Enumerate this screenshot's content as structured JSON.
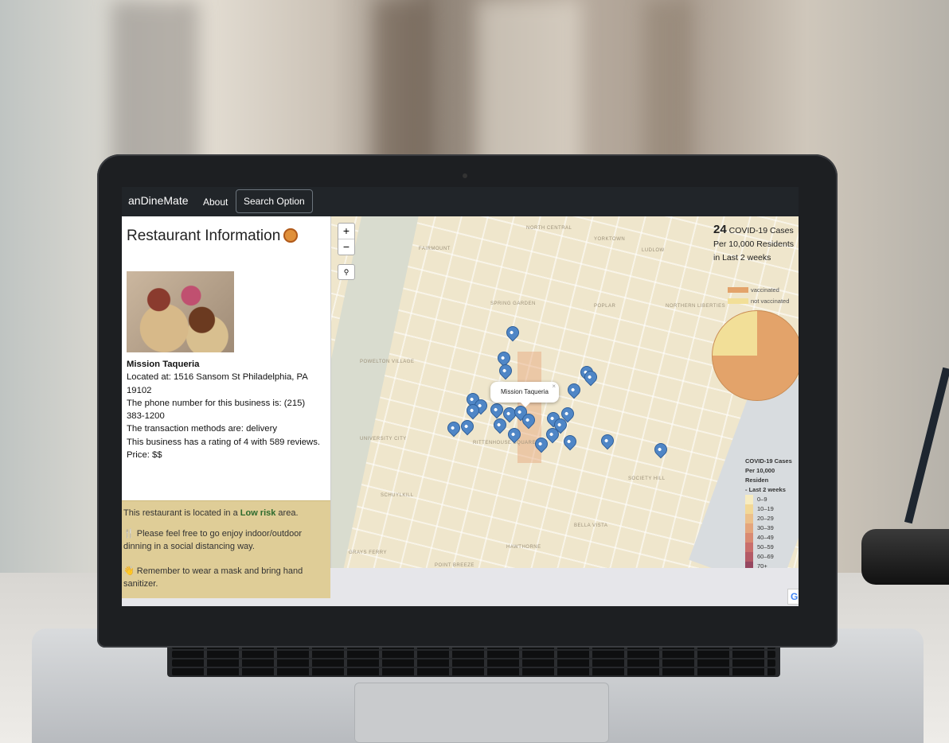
{
  "navbar": {
    "brand": "anDineMate",
    "about": "About",
    "search_option": "Search Option"
  },
  "panel": {
    "title": "Restaurant Information",
    "restaurant_name": "Mission Taqueria",
    "address_line1": "Located at: 1516 Sansom St Philadelphia, PA",
    "address_line2": "19102",
    "phone_line1": "The phone number for this business is: (215)",
    "phone_line2": "383-1200",
    "transaction": "The transaction methods are: delivery",
    "rating": "This business has a rating of 4 with 589 reviews.",
    "price": "Price: $$"
  },
  "risk": {
    "prefix": "This restaurant is located in a ",
    "level": "Low risk",
    "suffix": " area.",
    "tip1_line1": "Please feel free to go enjoy indoor/outdoor",
    "tip1_line2": "dinning in a social distancing way.",
    "tip2_line1": "Remember to wear a mask and bring hand",
    "tip2_line2": "sanitizer."
  },
  "map": {
    "zoom_in": "+",
    "zoom_out": "−",
    "popup_name": "Mission Taqueria",
    "popup_close": "×",
    "labels": [
      "NORTH CENTRAL",
      "YORKTOWN",
      "FAIRMOUNT",
      "LUDLOW",
      "SPRING GARDEN",
      "POPLAR",
      "NORTHERN LIBERTIES",
      "POWELTON VILLAGE",
      "UNIVERSITY CITY",
      "RITTENHOUSE SQUARE",
      "SCHUYLKILL",
      "SOCIETY HILL",
      "BELLA VISTA",
      "GRAYS FERRY",
      "HAWTHORNE",
      "POINT BREEZE"
    ],
    "stat_value": "24",
    "stat_line1": "COVID-19 Cases",
    "stat_line2": "Per 10,000 Residents",
    "stat_line3": "in Last 2 weeks",
    "legend_vaccinated": "vaccinated",
    "legend_not_vaccinated": "not vaccinated",
    "vaccinated_share_pct": 75,
    "scale_title1": "COVID-19 Cases",
    "scale_title2": "Per 10,000 Residen",
    "scale_title3": "- Last 2 weeks",
    "scale_bins": [
      "0–9",
      "10–19",
      "20–29",
      "30–39",
      "40–49",
      "50–59",
      "60–69",
      "70+"
    ],
    "scale_colors": [
      "#f7ecc0",
      "#f2d897",
      "#ecc08a",
      "#e4a57c",
      "#d98a72",
      "#c96f6c",
      "#b45a66",
      "#964760"
    ],
    "colors": {
      "vaccinated": "#e3a36a",
      "not_vaccinated": "#f2df98",
      "pin": "#4f86c6",
      "low_risk": "#2d6a2d"
    }
  },
  "badge": {
    "google": "G"
  }
}
